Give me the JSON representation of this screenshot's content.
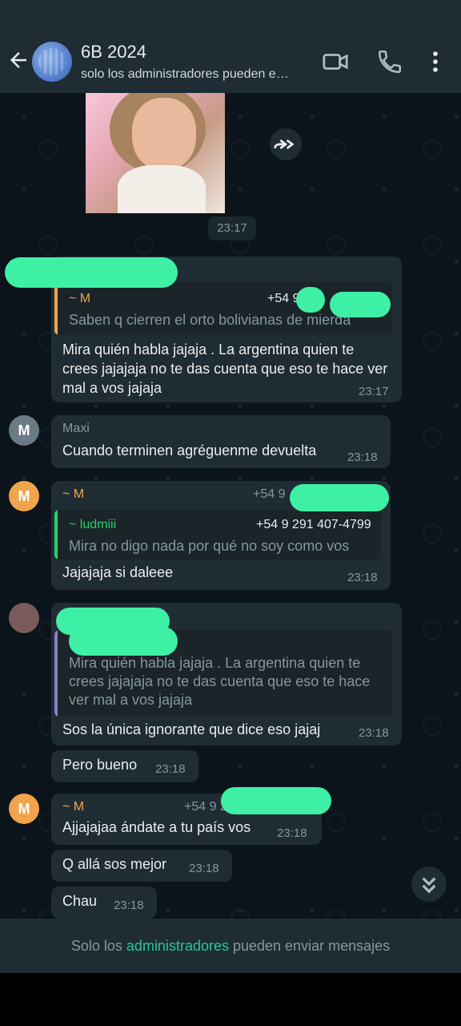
{
  "header": {
    "title": "6B 2024",
    "subtitle": "solo los administradores pueden e…"
  },
  "messages": {
    "img_time": "23:17",
    "m1": {
      "quote_name": "~ M",
      "quote_phone": "+54 9",
      "quote_text": "Saben q cierren el orto bolivianas de mierda",
      "text": "Mira quién habla jajaja . La argentina quien te crees jajajaja no te das cuenta que eso te hace ver mal a vos jajaja",
      "time": "23:17"
    },
    "m2": {
      "avatar": "M",
      "sender": "Maxi",
      "text": "Cuando terminen agréguenme devuelta",
      "time": "23:18"
    },
    "m3": {
      "avatar": "M",
      "sender": "~ M",
      "phone": "+54 9",
      "quote_name": "~ ludmiii",
      "quote_phone": "+54 9 291 407-4799",
      "quote_text": "Mira no digo nada por qué no soy como vos",
      "text": "Jajajaja si daleee",
      "time": "23:18"
    },
    "m4": {
      "quote_text": "Mira quién habla jajaja . La argentina quien te crees jajajaja no te das cuenta que eso te hace ver mal a vos jajaja",
      "text": "Sos la única ignorante que dice eso jajaj",
      "time": "23:18"
    },
    "m5": {
      "text": "Pero bueno",
      "time": "23:18"
    },
    "m6": {
      "avatar": "M",
      "sender": "~ M",
      "phone": "+54 9 2",
      "text": "Ajjajajaa ándate a tu país vos",
      "time": "23:18"
    },
    "m7": {
      "text": "Q allá sos mejor",
      "time": "23:18"
    },
    "m8": {
      "text": "Chau",
      "time": "23:18"
    }
  },
  "footer": {
    "prefix": "Solo los ",
    "link": "administradores",
    "suffix": " pueden enviar mensajes"
  },
  "colors": {
    "accent_green": "#2ec494",
    "sender_orange": "#f0a44b",
    "quote_green": "#25d366",
    "quote_purple": "#8a7fcf",
    "redaction": "#3ef0a6"
  }
}
